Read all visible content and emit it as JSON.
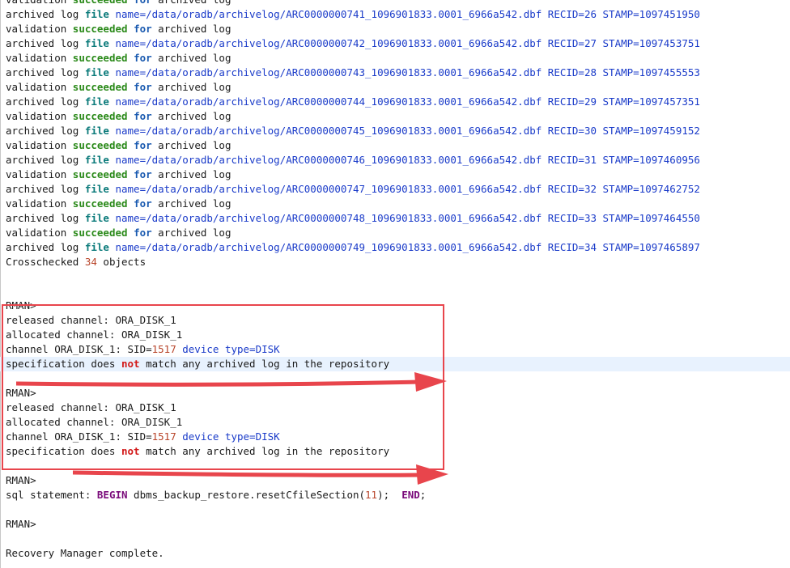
{
  "colors": {
    "keyword_success": "#2b8a1a",
    "keyword_file": "#0a7a7a",
    "path_text": "#1a3bc9",
    "negation": "#d21818",
    "number": "#b8452a",
    "sql_keyword": "#7a0a7a",
    "annotation_red": "#e8454c",
    "current_line_bg": "#e8f2fe"
  },
  "lines": [
    [
      {
        "t": "validation ",
        "c": "plain"
      },
      {
        "t": "succeeded",
        "c": "green"
      },
      {
        "t": " ",
        "c": "plain"
      },
      {
        "t": "for",
        "c": "kw"
      },
      {
        "t": " archived log",
        "c": "plain"
      }
    ],
    [
      {
        "t": "archived log ",
        "c": "plain"
      },
      {
        "t": "file",
        "c": "teal"
      },
      {
        "t": " name=/data/oradb/archivelog/ARC0000000741_1096901833.0001_6966a542.dbf RECID=26 STAMP=1097451950",
        "c": "blue"
      }
    ],
    [
      {
        "t": "validation ",
        "c": "plain"
      },
      {
        "t": "succeeded",
        "c": "green"
      },
      {
        "t": " ",
        "c": "plain"
      },
      {
        "t": "for",
        "c": "kw"
      },
      {
        "t": " archived log",
        "c": "plain"
      }
    ],
    [
      {
        "t": "archived log ",
        "c": "plain"
      },
      {
        "t": "file",
        "c": "teal"
      },
      {
        "t": " name=/data/oradb/archivelog/ARC0000000742_1096901833.0001_6966a542.dbf RECID=27 STAMP=1097453751",
        "c": "blue"
      }
    ],
    [
      {
        "t": "validation ",
        "c": "plain"
      },
      {
        "t": "succeeded",
        "c": "green"
      },
      {
        "t": " ",
        "c": "plain"
      },
      {
        "t": "for",
        "c": "kw"
      },
      {
        "t": " archived log",
        "c": "plain"
      }
    ],
    [
      {
        "t": "archived log ",
        "c": "plain"
      },
      {
        "t": "file",
        "c": "teal"
      },
      {
        "t": " name=/data/oradb/archivelog/ARC0000000743_1096901833.0001_6966a542.dbf RECID=28 STAMP=1097455553",
        "c": "blue"
      }
    ],
    [
      {
        "t": "validation ",
        "c": "plain"
      },
      {
        "t": "succeeded",
        "c": "green"
      },
      {
        "t": " ",
        "c": "plain"
      },
      {
        "t": "for",
        "c": "kw"
      },
      {
        "t": " archived log",
        "c": "plain"
      }
    ],
    [
      {
        "t": "archived log ",
        "c": "plain"
      },
      {
        "t": "file",
        "c": "teal"
      },
      {
        "t": " name=/data/oradb/archivelog/ARC0000000744_1096901833.0001_6966a542.dbf RECID=29 STAMP=1097457351",
        "c": "blue"
      }
    ],
    [
      {
        "t": "validation ",
        "c": "plain"
      },
      {
        "t": "succeeded",
        "c": "green"
      },
      {
        "t": " ",
        "c": "plain"
      },
      {
        "t": "for",
        "c": "kw"
      },
      {
        "t": " archived log",
        "c": "plain"
      }
    ],
    [
      {
        "t": "archived log ",
        "c": "plain"
      },
      {
        "t": "file",
        "c": "teal"
      },
      {
        "t": " name=/data/oradb/archivelog/ARC0000000745_1096901833.0001_6966a542.dbf RECID=30 STAMP=1097459152",
        "c": "blue"
      }
    ],
    [
      {
        "t": "validation ",
        "c": "plain"
      },
      {
        "t": "succeeded",
        "c": "green"
      },
      {
        "t": " ",
        "c": "plain"
      },
      {
        "t": "for",
        "c": "kw"
      },
      {
        "t": " archived log",
        "c": "plain"
      }
    ],
    [
      {
        "t": "archived log ",
        "c": "plain"
      },
      {
        "t": "file",
        "c": "teal"
      },
      {
        "t": " name=/data/oradb/archivelog/ARC0000000746_1096901833.0001_6966a542.dbf RECID=31 STAMP=1097460956",
        "c": "blue"
      }
    ],
    [
      {
        "t": "validation ",
        "c": "plain"
      },
      {
        "t": "succeeded",
        "c": "green"
      },
      {
        "t": " ",
        "c": "plain"
      },
      {
        "t": "for",
        "c": "kw"
      },
      {
        "t": " archived log",
        "c": "plain"
      }
    ],
    [
      {
        "t": "archived log ",
        "c": "plain"
      },
      {
        "t": "file",
        "c": "teal"
      },
      {
        "t": " name=/data/oradb/archivelog/ARC0000000747_1096901833.0001_6966a542.dbf RECID=32 STAMP=1097462752",
        "c": "blue"
      }
    ],
    [
      {
        "t": "validation ",
        "c": "plain"
      },
      {
        "t": "succeeded",
        "c": "green"
      },
      {
        "t": " ",
        "c": "plain"
      },
      {
        "t": "for",
        "c": "kw"
      },
      {
        "t": " archived log",
        "c": "plain"
      }
    ],
    [
      {
        "t": "archived log ",
        "c": "plain"
      },
      {
        "t": "file",
        "c": "teal"
      },
      {
        "t": " name=/data/oradb/archivelog/ARC0000000748_1096901833.0001_6966a542.dbf RECID=33 STAMP=1097464550",
        "c": "blue"
      }
    ],
    [
      {
        "t": "validation ",
        "c": "plain"
      },
      {
        "t": "succeeded",
        "c": "green"
      },
      {
        "t": " ",
        "c": "plain"
      },
      {
        "t": "for",
        "c": "kw"
      },
      {
        "t": " archived log",
        "c": "plain"
      }
    ],
    [
      {
        "t": "archived log ",
        "c": "plain"
      },
      {
        "t": "file",
        "c": "teal"
      },
      {
        "t": " name=/data/oradb/archivelog/ARC0000000749_1096901833.0001_6966a542.dbf RECID=34 STAMP=1097465897",
        "c": "blue"
      }
    ],
    [
      {
        "t": "Crosschecked ",
        "c": "plain"
      },
      {
        "t": "34",
        "c": "num"
      },
      {
        "t": " objects",
        "c": "plain"
      }
    ],
    [],
    [],
    [
      {
        "t": "RMAN>",
        "c": "plain"
      }
    ],
    [
      {
        "t": "released channel: ORA_DISK_1",
        "c": "plain"
      }
    ],
    [
      {
        "t": "allocated channel: ORA_DISK_1",
        "c": "plain"
      }
    ],
    [
      {
        "t": "channel ORA_DISK_1: SID=",
        "c": "plain"
      },
      {
        "t": "1517",
        "c": "num"
      },
      {
        "t": " device type=DISK",
        "c": "blue"
      }
    ],
    [
      {
        "t": "specification does ",
        "c": "plain"
      },
      {
        "t": "not",
        "c": "red"
      },
      {
        "t": " match any archived log in the repository",
        "c": "plain"
      }
    ],
    [],
    [
      {
        "t": "RMAN>",
        "c": "plain"
      }
    ],
    [
      {
        "t": "released channel: ORA_DISK_1",
        "c": "plain"
      }
    ],
    [
      {
        "t": "allocated channel: ORA_DISK_1",
        "c": "plain"
      }
    ],
    [
      {
        "t": "channel ORA_DISK_1: SID=",
        "c": "plain"
      },
      {
        "t": "1517",
        "c": "num"
      },
      {
        "t": " device type=DISK",
        "c": "blue"
      }
    ],
    [
      {
        "t": "specification does ",
        "c": "plain"
      },
      {
        "t": "not",
        "c": "red"
      },
      {
        "t": " match any archived log in the repository",
        "c": "plain"
      }
    ],
    [],
    [
      {
        "t": "RMAN>",
        "c": "plain"
      }
    ],
    [
      {
        "t": "sql statement: ",
        "c": "plain"
      },
      {
        "t": "BEGIN",
        "c": "purple"
      },
      {
        "t": " dbms_backup_restore.resetCfileSection(",
        "c": "plain"
      },
      {
        "t": "11",
        "c": "num"
      },
      {
        "t": ");  ",
        "c": "plain"
      },
      {
        "t": "END",
        "c": "purple"
      },
      {
        "t": ";",
        "c": "plain"
      }
    ],
    [],
    [
      {
        "t": "RMAN>",
        "c": "plain"
      }
    ],
    [],
    [
      {
        "t": "Recovery Manager complete.",
        "c": "plain"
      }
    ]
  ],
  "current_line_index": 25
}
